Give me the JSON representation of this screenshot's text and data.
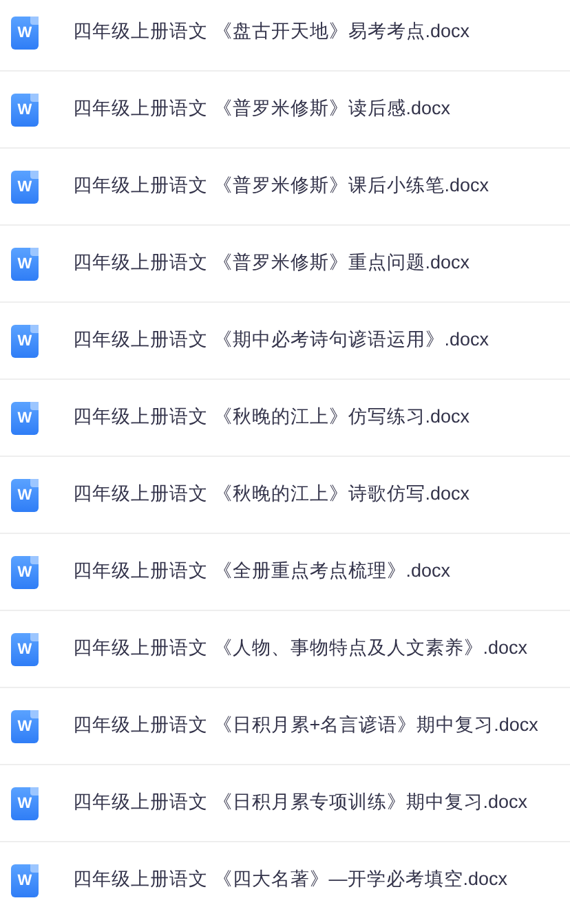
{
  "files": [
    {
      "icon_label": "W",
      "name": "四年级上册语文 《盘古开天地》易考考点.docx"
    },
    {
      "icon_label": "W",
      "name": "四年级上册语文 《普罗米修斯》读后感.docx"
    },
    {
      "icon_label": "W",
      "name": "四年级上册语文 《普罗米修斯》课后小练笔.docx"
    },
    {
      "icon_label": "W",
      "name": "四年级上册语文 《普罗米修斯》重点问题.docx"
    },
    {
      "icon_label": "W",
      "name": "四年级上册语文 《期中必考诗句谚语运用》.docx"
    },
    {
      "icon_label": "W",
      "name": "四年级上册语文 《秋晚的江上》仿写练习.docx"
    },
    {
      "icon_label": "W",
      "name": "四年级上册语文 《秋晚的江上》诗歌仿写.docx"
    },
    {
      "icon_label": "W",
      "name": "四年级上册语文 《全册重点考点梳理》.docx"
    },
    {
      "icon_label": "W",
      "name": "四年级上册语文 《人物、事物特点及人文素养》.docx"
    },
    {
      "icon_label": "W",
      "name": "四年级上册语文 《日积月累+名言谚语》期中复习.docx"
    },
    {
      "icon_label": "W",
      "name": "四年级上册语文 《日积月累专项训练》期中复习.docx"
    },
    {
      "icon_label": "W",
      "name": "四年级上册语文 《四大名著》—开学必考填空.docx"
    }
  ]
}
